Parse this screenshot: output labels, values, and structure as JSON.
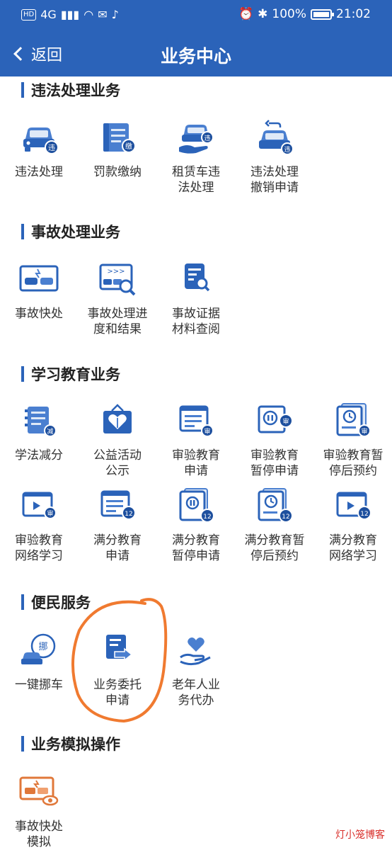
{
  "status_bar": {
    "left_badge": "HD",
    "network": "4G",
    "battery": "100%",
    "time": "21:02"
  },
  "navbar": {
    "back_label": "返回",
    "title": "业务中心"
  },
  "sections": [
    {
      "title": "违法处理业务",
      "items": [
        {
          "label": "违法处理",
          "icon": "car-violation-icon"
        },
        {
          "label": "罚款缴纳",
          "icon": "fine-payment-icon"
        },
        {
          "label": "租赁车违\n法处理",
          "icon": "rental-car-violation-icon"
        },
        {
          "label": "违法处理\n撤销申请",
          "icon": "violation-revoke-icon"
        }
      ]
    },
    {
      "title": "事故处理业务",
      "items": [
        {
          "label": "事故快处",
          "icon": "accident-quick-icon"
        },
        {
          "label": "事故处理进\n度和结果",
          "icon": "accident-progress-icon"
        },
        {
          "label": "事故证据\n材料查阅",
          "icon": "evidence-lookup-icon"
        }
      ]
    },
    {
      "title": "学习教育业务",
      "items": [
        {
          "label": "学法减分",
          "icon": "study-reduce-icon"
        },
        {
          "label": "公益活动\n公示",
          "icon": "charity-notice-icon"
        },
        {
          "label": "审验教育\n申请",
          "icon": "review-education-icon"
        },
        {
          "label": "审验教育\n暂停申请",
          "icon": "review-pause-icon"
        },
        {
          "label": "审验教育暂\n停后预约",
          "icon": "review-appointment-icon"
        },
        {
          "label": "审验教育\n网络学习",
          "icon": "review-online-icon"
        },
        {
          "label": "满分教育\n申请",
          "icon": "full-score-icon"
        },
        {
          "label": "满分教育\n暂停申请",
          "icon": "full-score-pause-icon"
        },
        {
          "label": "满分教育暂\n停后预约",
          "icon": "full-score-appointment-icon"
        },
        {
          "label": "满分教育\n网络学习",
          "icon": "full-score-online-icon"
        }
      ]
    },
    {
      "title": "便民服务",
      "items": [
        {
          "label": "一键挪车",
          "icon": "move-car-icon"
        },
        {
          "label": "业务委托\n申请",
          "icon": "delegation-icon"
        },
        {
          "label": "老年人业\n务代办",
          "icon": "elderly-service-icon"
        }
      ]
    },
    {
      "title": "业务模拟操作",
      "items": [
        {
          "label": "事故快处\n模拟",
          "icon": "accident-simulation-icon"
        }
      ]
    }
  ],
  "badges": {
    "violation": "违",
    "pay": "缴",
    "reduce": "减",
    "review": "审",
    "score": "12",
    "move": "挪"
  },
  "watermark": "灯小笼博客",
  "colors": {
    "primary": "#2b63b9",
    "annotation": "#f07a30"
  }
}
